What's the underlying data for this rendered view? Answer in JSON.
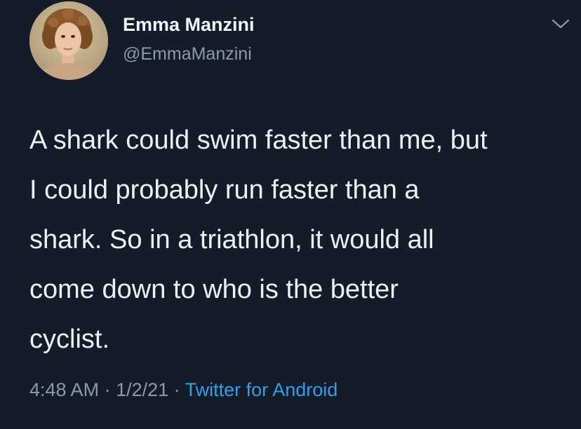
{
  "author": {
    "display_name": "Emma Manzini",
    "handle": "@EmmaManzini",
    "avatar_icon": "portrait-avatar"
  },
  "menu": {
    "icon": "chevron-down-icon"
  },
  "tweet": {
    "text": "A shark could swim faster than me, but\nI could probably run faster than a\nshark. So in a triathlon, it would all\ncome down to who is the better\ncyclist."
  },
  "meta": {
    "time": "4:48 AM",
    "separator_1": " · ",
    "date": "1/2/21",
    "separator_2": " · ",
    "source": "Twitter for Android"
  },
  "colors": {
    "background": "#151c29",
    "text": "#eef1f4",
    "secondary": "#8d99a6",
    "link": "#2f9fe8"
  }
}
